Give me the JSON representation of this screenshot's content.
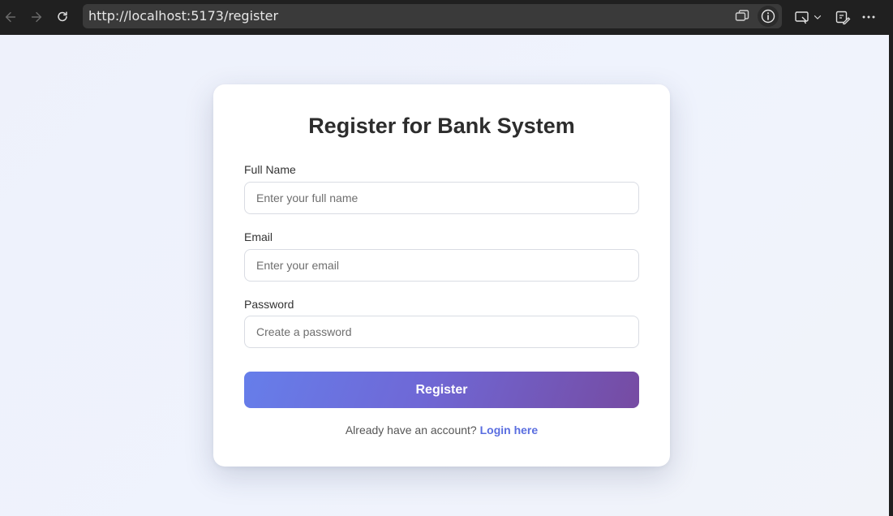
{
  "browser": {
    "url": "http://localhost:5173/register",
    "icons": [
      "back-arrow-icon",
      "forward-arrow-icon",
      "reload-icon",
      "tab-switch-icon",
      "info-icon",
      "cast-icon",
      "chevron-down-icon",
      "extensions-icon",
      "more-icon"
    ]
  },
  "form": {
    "title": "Register for Bank System",
    "fields": [
      {
        "label": "Full Name",
        "placeholder": "Enter your full name"
      },
      {
        "label": "Email",
        "placeholder": "Enter your email"
      },
      {
        "label": "Password",
        "placeholder": "Create a password"
      }
    ],
    "submit_label": "Register",
    "footer_text": "Already have an account?",
    "footer_link": "Login here"
  },
  "colors": {
    "gradient_start": "#667eea",
    "gradient_end": "#764ba2",
    "link": "#5a6ee0",
    "page_bg": "#eef1fb"
  }
}
